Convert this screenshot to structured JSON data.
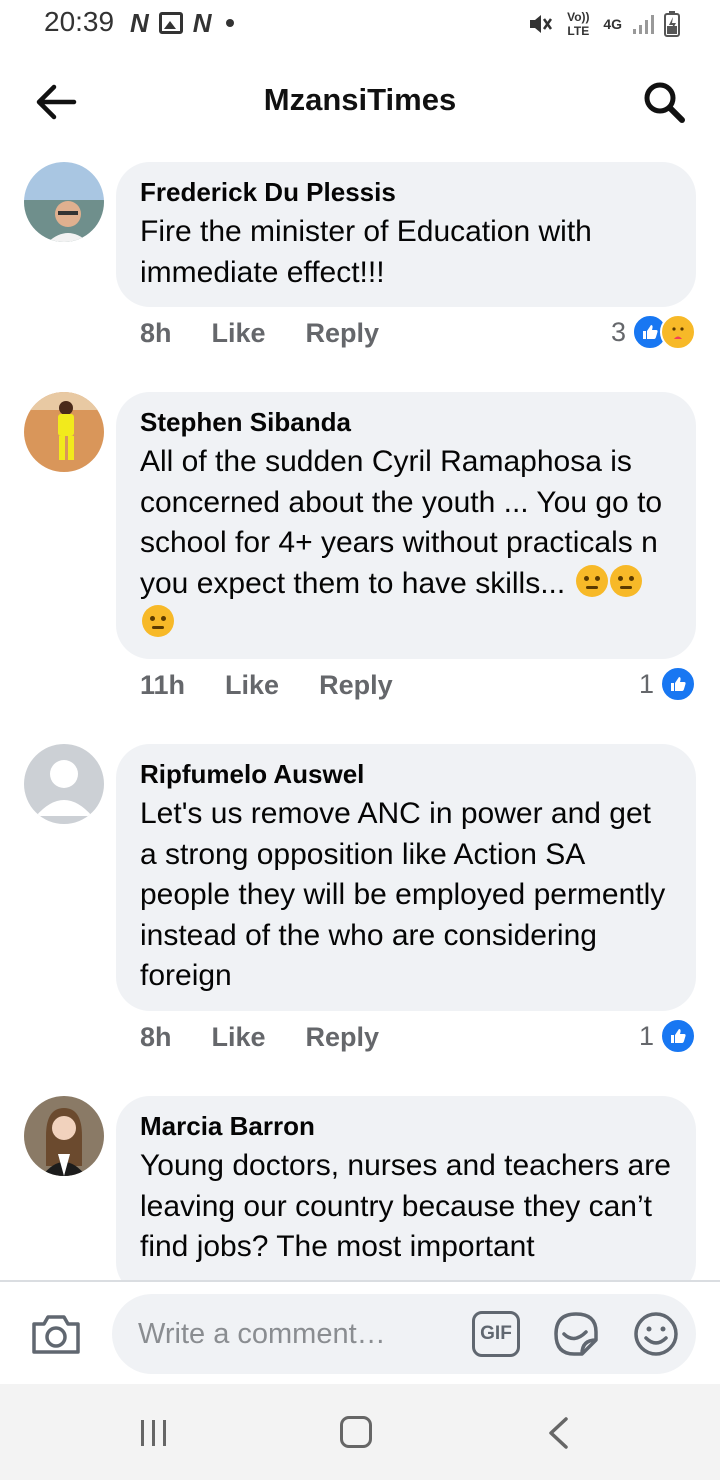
{
  "status_bar": {
    "time": "20:39",
    "left_icons": [
      "news-icon",
      "image-icon",
      "news-icon",
      "dot"
    ],
    "n_glyph": "N",
    "volte_label": "Vo)) LTE",
    "network_label": "4G"
  },
  "header": {
    "title": "MzansiTimes"
  },
  "comments": [
    {
      "author": "Frederick Du Plessis",
      "text": "Fire the minister of Education with immediate effect!!!",
      "time": "8h",
      "like_label": "Like",
      "reply_label": "Reply",
      "reaction_count": "3",
      "reactions": [
        "like",
        "care"
      ]
    },
    {
      "author": "Stephen Sibanda",
      "text": "All of the sudden Cyril Ramaphosa is concerned about the youth ... You go to school for 4+ years without practicals n you expect them to have skills...",
      "emoji_count": 3,
      "emoji_name": "thinking-face",
      "time": "11h",
      "like_label": "Like",
      "reply_label": "Reply",
      "reaction_count": "1",
      "reactions": [
        "like"
      ]
    },
    {
      "author": "Ripfumelo Auswel",
      "text": "Let's us remove  ANC in power and get a strong opposition like Action SA people they will be employed permently  instead of the who are considering foreign",
      "time": "8h",
      "like_label": "Like",
      "reply_label": "Reply",
      "reaction_count": "1",
      "reactions": [
        "like"
      ]
    },
    {
      "author": "Marcia Barron",
      "text": "Young doctors, nurses and teachers are leaving our country because they can’t find jobs? The most important"
    }
  ],
  "composer": {
    "placeholder": "Write a comment…",
    "gif_label": "GIF"
  },
  "colors": {
    "bubble": "#f0f2f5",
    "like_blue": "#1877f2",
    "meta_gray": "#65676b",
    "nav_bg": "#f3f3f3"
  }
}
